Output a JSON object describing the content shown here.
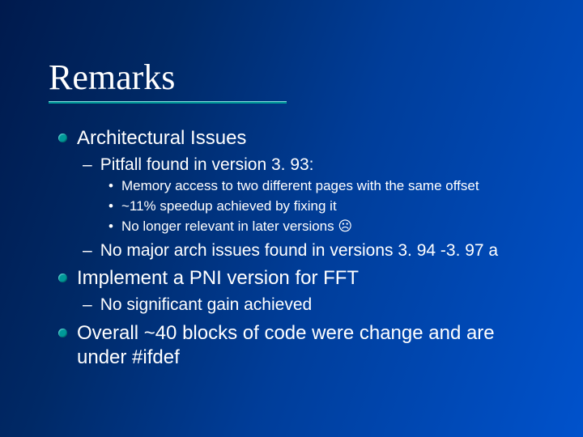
{
  "slide": {
    "title": "Remarks",
    "items": [
      {
        "text": "Architectural Issues",
        "children": [
          {
            "text": "Pitfall found in version 3. 93:",
            "children": [
              {
                "text": "Memory access to two different pages with the same offset"
              },
              {
                "text": "~11% speedup achieved by fixing it"
              },
              {
                "text": "No longer relevant in later versions ☹"
              }
            ]
          },
          {
            "text": "No major arch issues found in versions 3. 94 -3. 97 a",
            "children": []
          }
        ]
      },
      {
        "text": "Implement a PNI version for FFT",
        "children": [
          {
            "text": "No significant gain achieved",
            "children": []
          }
        ]
      },
      {
        "text": "Overall ~40 blocks of code were change and are under #ifdef",
        "children": []
      }
    ]
  },
  "glyphs": {
    "dash": "–",
    "dot": "•"
  }
}
